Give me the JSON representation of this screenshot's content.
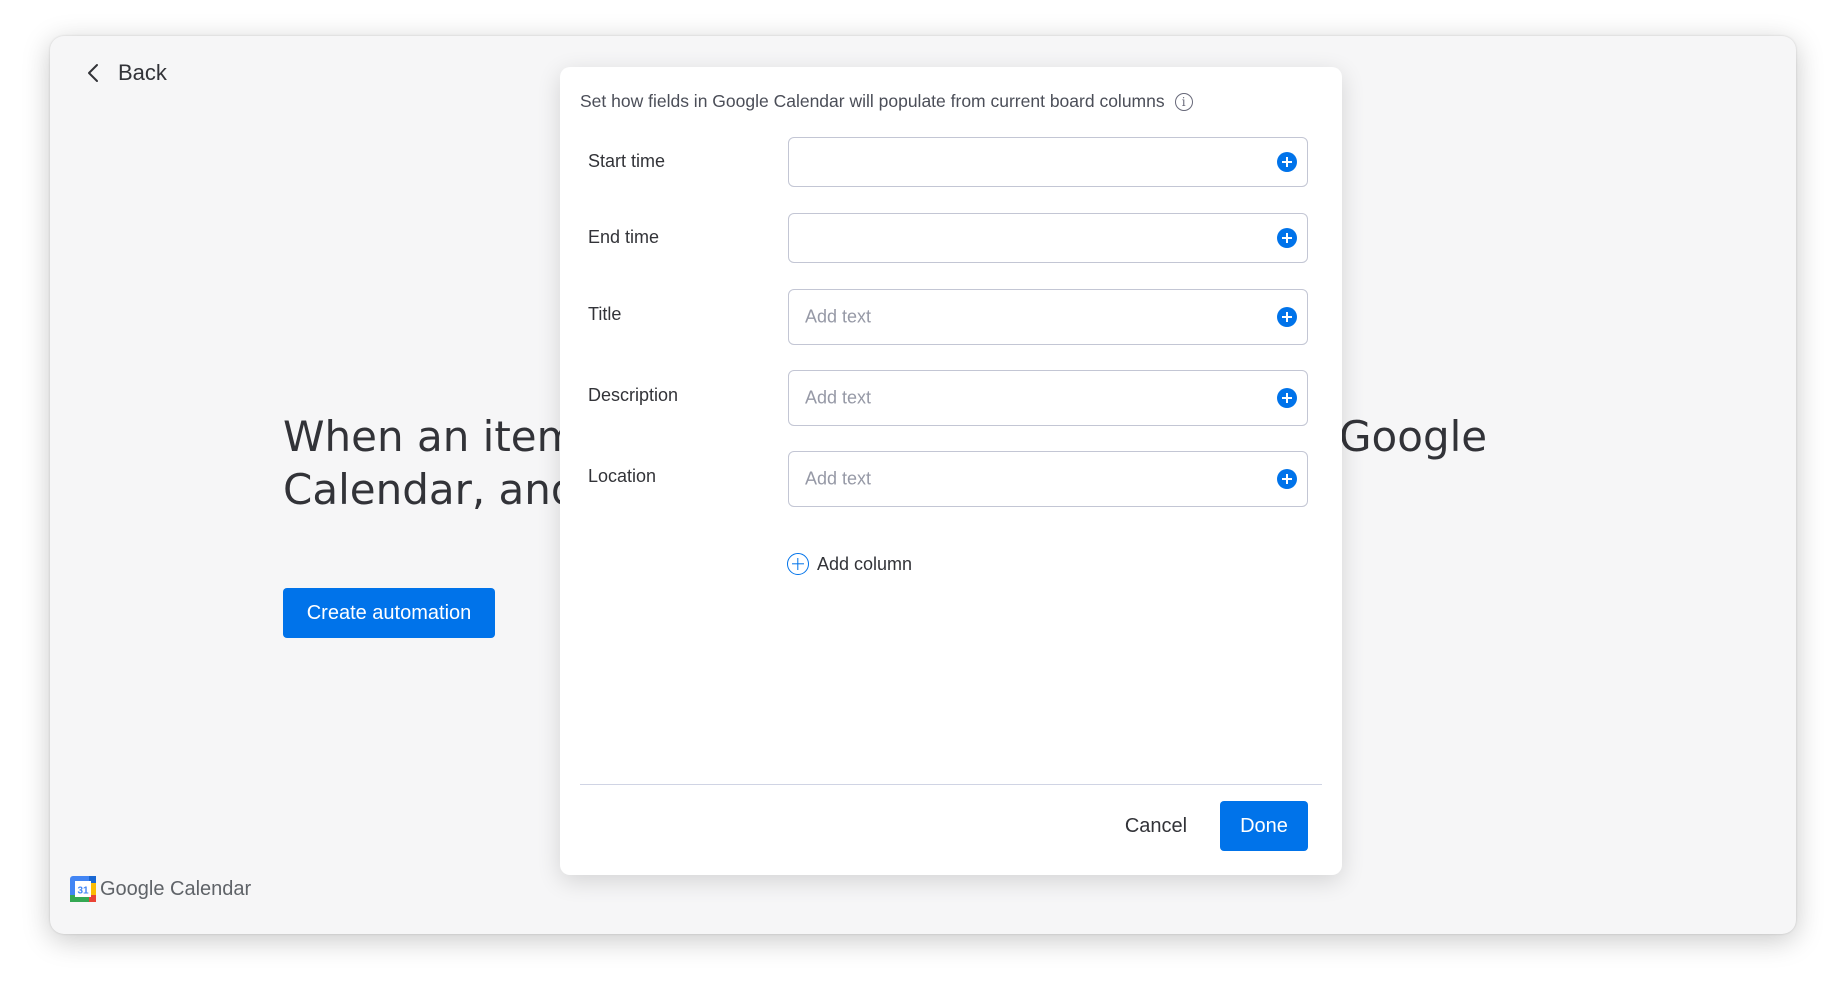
{
  "back": {
    "label": "Back"
  },
  "hero": {
    "line1": "When an item",
    "line2": "Calendar, and",
    "right_fragment": "Google",
    "create_button": "Create automation"
  },
  "brand": {
    "badge": "31",
    "name": "Google Calendar"
  },
  "modal": {
    "header": "Set how fields in Google Calendar will populate from current board columns",
    "info_glyph": "i",
    "fields": [
      {
        "label": "Start time",
        "value": "",
        "placeholder": ""
      },
      {
        "label": "End time",
        "value": "",
        "placeholder": ""
      },
      {
        "label": "Title",
        "value": "",
        "placeholder": "Add text"
      },
      {
        "label": "Description",
        "value": "",
        "placeholder": "Add text"
      },
      {
        "label": "Location",
        "value": "",
        "placeholder": "Add text"
      }
    ],
    "add_column": "Add column",
    "cancel": "Cancel",
    "done": "Done"
  },
  "colors": {
    "accent": "#0073ea",
    "text": "#323338",
    "placeholder": "#9699a6",
    "border": "#c3c6d4",
    "background": "#f6f6f7"
  }
}
